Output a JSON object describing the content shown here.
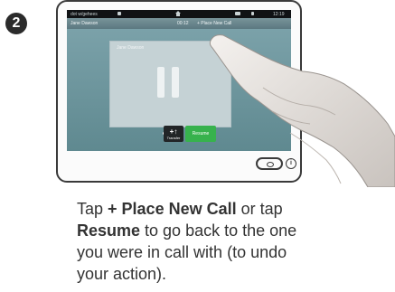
{
  "step": {
    "number": "2"
  },
  "screen": {
    "status": {
      "left_label": "dot w/gehees",
      "center_icon": "home-icon",
      "right_time": "12:19"
    },
    "call_bar": {
      "caller": "Jane Dawson",
      "duration": "00:12",
      "place_new_call": "+ Place New Call"
    },
    "held_call": {
      "name": "Jane Dawson",
      "state_icon": "pause-icon"
    },
    "page_indicator": {
      "count": 2,
      "active": 1
    },
    "buttons": {
      "transfer_glyph": "+↑",
      "transfer_label": "Transfer",
      "resume_label": "Resume"
    }
  },
  "instruction": {
    "line1_pre": "Tap ",
    "line1_bold": "+ Place New Call",
    "line1_post": " or tap",
    "line2_bold": "Resume",
    "line2_post": " to go back to the one",
    "line3": "you were in call with (to undo",
    "line4": "your action)."
  },
  "colors": {
    "resume_green": "#37b24d",
    "screen_teal": "#6f979e",
    "badge_dark": "#2b2b2b"
  }
}
